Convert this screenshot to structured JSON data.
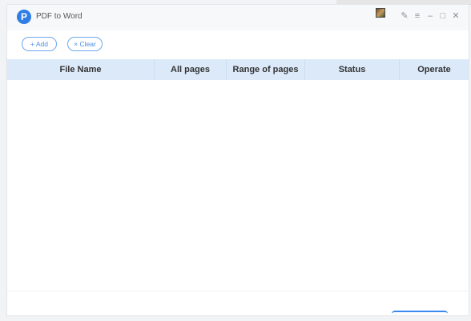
{
  "window": {
    "title": "PDF to Word",
    "logo_letter": "P"
  },
  "window_controls": [
    {
      "name": "edit-icon",
      "glyph": "✎"
    },
    {
      "name": "menu-icon",
      "glyph": "≡"
    },
    {
      "name": "minimize-icon",
      "glyph": "–"
    },
    {
      "name": "maximize-icon",
      "glyph": "□"
    },
    {
      "name": "close-icon",
      "glyph": "✕"
    }
  ],
  "toolbar": {
    "add_label": "+ Add",
    "clear_label": "× Clear"
  },
  "table": {
    "columns": [
      "File Name",
      "All pages",
      "Range of pages",
      "Status",
      "Operate"
    ],
    "rows": []
  },
  "colors": {
    "accent": "#2f7ee6",
    "header_bg": "#dbe9f9"
  }
}
